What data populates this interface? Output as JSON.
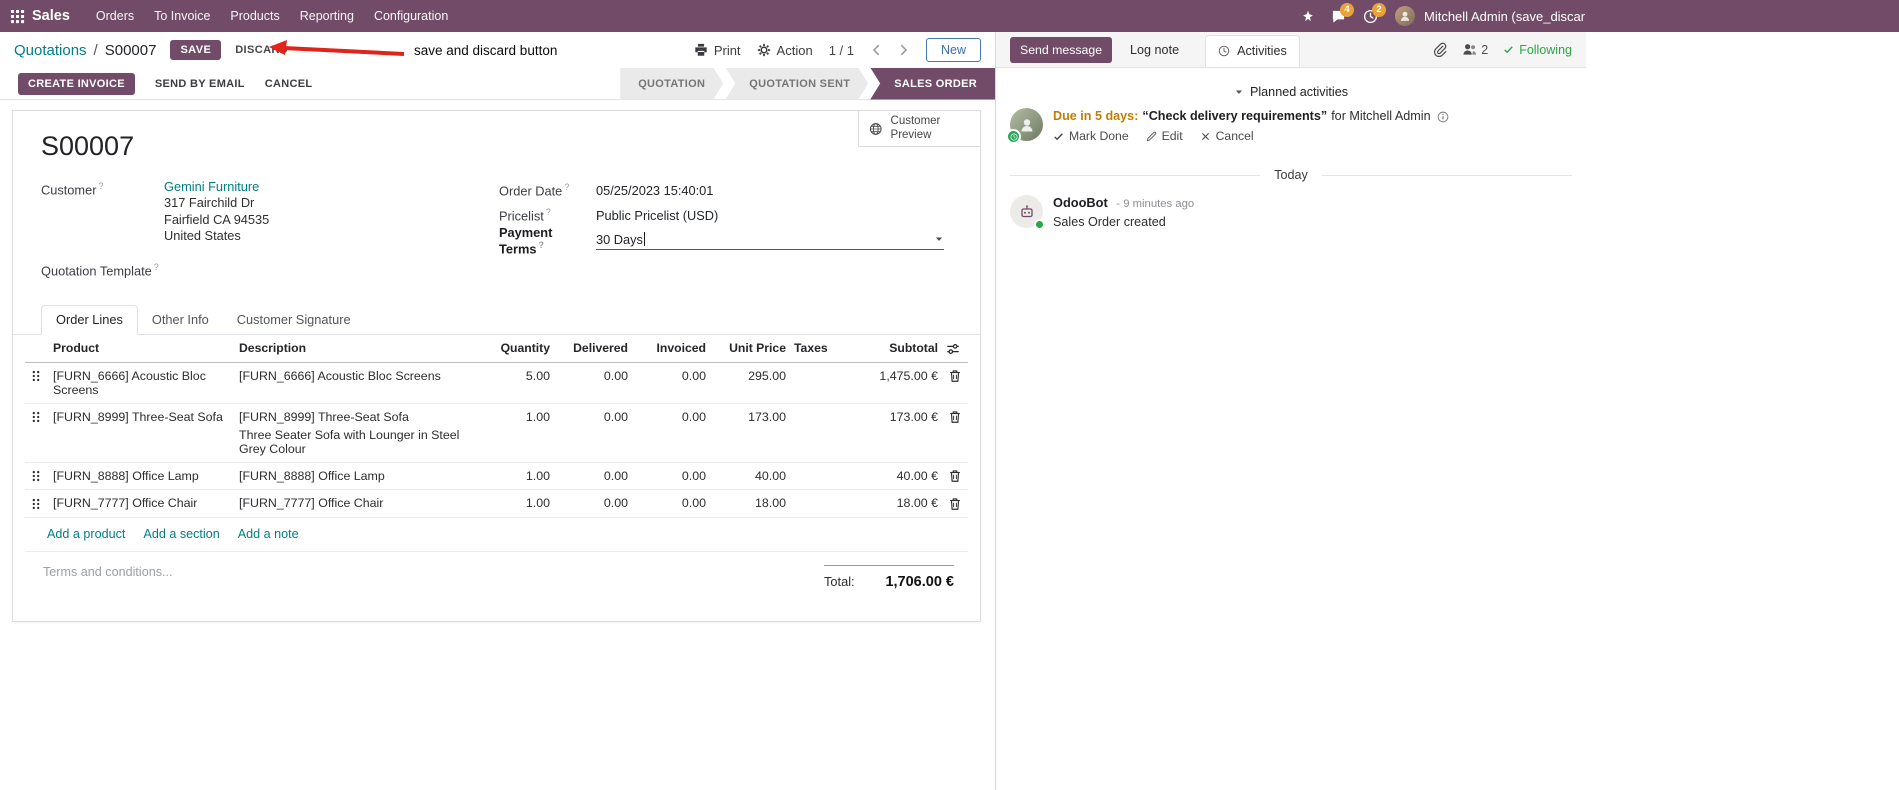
{
  "top_nav": {
    "app_name": "Sales",
    "menus": [
      "Orders",
      "To Invoice",
      "Products",
      "Reporting",
      "Configuration"
    ],
    "messages_badge": "4",
    "activities_badge": "2",
    "user_name": "Mitchell Admin (save_discar"
  },
  "control_panel": {
    "breadcrumb_parent": "Quotations",
    "breadcrumb_separator": "/",
    "breadcrumb_current": "S00007",
    "save": "SAVE",
    "discard": "DISCARD",
    "print": "Print",
    "action": "Action",
    "pager": "1 / 1",
    "new": "New"
  },
  "annotation": {
    "label": "save and discard button"
  },
  "statusbar": {
    "create_invoice": "CREATE INVOICE",
    "send_by_email": "SEND BY EMAIL",
    "cancel": "CANCEL",
    "stages": [
      {
        "label": "QUOTATION"
      },
      {
        "label": "QUOTATION SENT"
      },
      {
        "label": "SALES ORDER"
      }
    ]
  },
  "sheet": {
    "customer_preview": "Customer Preview",
    "title": "S00007",
    "help_marker": "?",
    "fields": {
      "customer_label": "Customer",
      "customer_name": "Gemini Furniture",
      "address_line1": "317 Fairchild Dr",
      "address_line2": "Fairfield CA 94535",
      "address_line3": "United States",
      "quotation_template_label": "Quotation Template",
      "order_date_label": "Order Date",
      "order_date_value": "05/25/2023 15:40:01",
      "pricelist_label": "Pricelist",
      "pricelist_value": "Public Pricelist (USD)",
      "payment_terms_label": "Payment Terms",
      "payment_terms_value": "30 Days"
    },
    "tabs": [
      {
        "label": "Order Lines"
      },
      {
        "label": "Other Info"
      },
      {
        "label": "Customer Signature"
      }
    ],
    "table": {
      "headers": {
        "product": "Product",
        "description": "Description",
        "quantity": "Quantity",
        "delivered": "Delivered",
        "invoiced": "Invoiced",
        "unit_price": "Unit Price",
        "taxes": "Taxes",
        "subtotal": "Subtotal"
      },
      "rows": [
        {
          "product": "[FURN_6666] Acoustic Bloc Screens",
          "description": "[FURN_6666] Acoustic Bloc Screens",
          "quantity": "5.00",
          "delivered": "0.00",
          "invoiced": "0.00",
          "unit_price": "295.00",
          "taxes": "",
          "subtotal": "1,475.00 €"
        },
        {
          "product": "[FURN_8999] Three-Seat Sofa",
          "description": "[FURN_8999] Three-Seat Sofa",
          "description_line2": "Three Seater Sofa with Lounger in Steel Grey Colour",
          "quantity": "1.00",
          "delivered": "0.00",
          "invoiced": "0.00",
          "unit_price": "173.00",
          "taxes": "",
          "subtotal": "173.00 €"
        },
        {
          "product": "[FURN_8888] Office Lamp",
          "description": "[FURN_8888] Office Lamp",
          "quantity": "1.00",
          "delivered": "0.00",
          "invoiced": "0.00",
          "unit_price": "40.00",
          "taxes": "",
          "subtotal": "40.00 €"
        },
        {
          "product": "[FURN_7777] Office Chair",
          "description": "[FURN_7777] Office Chair",
          "quantity": "1.00",
          "delivered": "0.00",
          "invoiced": "0.00",
          "unit_price": "18.00",
          "taxes": "",
          "subtotal": "18.00 €"
        }
      ],
      "add_product": "Add a product",
      "add_section": "Add a section",
      "add_note": "Add a note"
    },
    "terms_placeholder": "Terms and conditions...",
    "total_label": "Total:",
    "total_value": "1,706.00 €"
  },
  "chatter": {
    "send_message": "Send message",
    "log_note": "Log note",
    "activities": "Activities",
    "followers_count": "2",
    "following": "Following",
    "planned_activities": "Planned activities",
    "activity": {
      "due": "Due in 5 days:",
      "summary": "“Check delivery requirements”",
      "assignee": "for Mitchell Admin",
      "mark_done": "Mark Done",
      "edit": "Edit",
      "cancel": "Cancel"
    },
    "date_separator": "Today",
    "message": {
      "author": "OdooBot",
      "time": "- 9 minutes ago",
      "body": "Sales Order created"
    }
  }
}
